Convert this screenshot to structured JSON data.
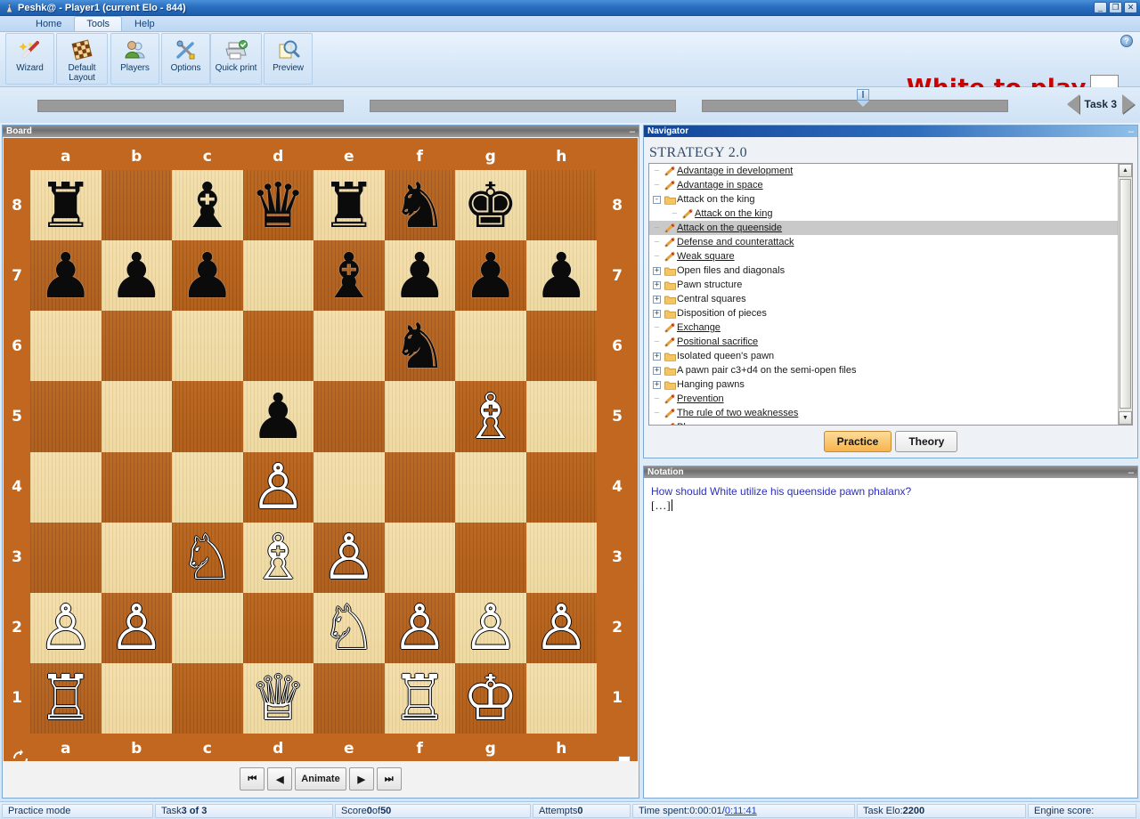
{
  "window": {
    "title": "Peshk@ - Player1 (current Elo - 844)",
    "icon": "chess-pawn-icon",
    "minimize": "_",
    "maximize": "❐",
    "close": "✕"
  },
  "tabs": [
    {
      "label": "Home",
      "active": false
    },
    {
      "label": "Tools",
      "active": true
    },
    {
      "label": "Help",
      "active": false
    }
  ],
  "ribbon": {
    "help_icon": "?",
    "buttons": [
      {
        "label": "Wizard",
        "icon": "magic-wand-icon"
      },
      {
        "label": "Default Layout",
        "line1": "Default",
        "line2": "Layout",
        "icon": "checkerboard-icon"
      },
      {
        "label": "Players",
        "icon": "users-icon"
      },
      {
        "label": "Options",
        "icon": "tools-icon"
      },
      {
        "label": "Quick print",
        "icon": "printer-check-icon"
      },
      {
        "label": "Preview",
        "icon": "magnifier-page-icon"
      }
    ],
    "turn_banner": "White to play",
    "turn_color_swatch": "#ffffff",
    "turn_text_color": "#cc0000"
  },
  "task_nav": {
    "prev_icon": "arrow-left-icon",
    "next_icon": "arrow-right-icon",
    "label": "Task  3"
  },
  "board_panel": {
    "title": "Board",
    "minimize": "–",
    "files": [
      "a",
      "b",
      "c",
      "d",
      "e",
      "f",
      "g",
      "h"
    ],
    "ranks": [
      "8",
      "7",
      "6",
      "5",
      "4",
      "3",
      "2",
      "1"
    ],
    "flip_icon": "flip-board-icon",
    "light_square_color": "#eed9a2",
    "dark_square_color": "#b1601d",
    "border_color": "#c1671f",
    "position": [
      [
        "r",
        "",
        "b",
        "q",
        "r",
        "n",
        "k",
        ""
      ],
      [
        "p",
        "p",
        "p",
        "",
        "b",
        "p",
        "p",
        "p"
      ],
      [
        "",
        "",
        "",
        "",
        "",
        "n",
        "",
        ""
      ],
      [
        "",
        "",
        "",
        "p",
        "",
        "",
        "B",
        ""
      ],
      [
        "",
        "",
        "",
        "P",
        "",
        "",
        "",
        ""
      ],
      [
        "",
        "",
        "N",
        "B",
        "P",
        "",
        "",
        ""
      ],
      [
        "P",
        "P",
        "",
        "",
        "N",
        "P",
        "P",
        "P"
      ],
      [
        "R",
        "",
        "",
        "Q",
        "",
        "R",
        "K",
        ""
      ]
    ],
    "controls": [
      {
        "label": "⏮",
        "name": "first-move-button"
      },
      {
        "label": "◀",
        "name": "previous-move-button"
      },
      {
        "label": "Animate",
        "name": "animate-button"
      },
      {
        "label": "▶",
        "name": "next-move-button"
      },
      {
        "label": "⏭",
        "name": "last-move-button"
      }
    ]
  },
  "navigator": {
    "title": "Navigator",
    "minimize": "–",
    "heading": "STRATEGY 2.0",
    "tree": [
      {
        "label": "Advantage in development",
        "level": 0,
        "type": "leaf",
        "link": true,
        "selected": false
      },
      {
        "label": "Advantage in space",
        "level": 0,
        "type": "leaf",
        "link": true,
        "selected": false
      },
      {
        "label": "Attack on the king",
        "level": 0,
        "type": "folder",
        "expander": "-",
        "link": false,
        "selected": false
      },
      {
        "label": "Attack on the king",
        "level": 1,
        "type": "leaf",
        "link": true,
        "selected": false
      },
      {
        "label": "Attack on the queenside",
        "level": 0,
        "type": "leaf",
        "link": true,
        "selected": true
      },
      {
        "label": "Defense and counterattack",
        "level": 0,
        "type": "leaf",
        "link": true,
        "selected": false
      },
      {
        "label": "Weak square",
        "level": 0,
        "type": "leaf",
        "link": true,
        "selected": false
      },
      {
        "label": "Open files and diagonals",
        "level": 0,
        "type": "folder",
        "expander": "+",
        "link": false,
        "selected": false
      },
      {
        "label": "Pawn structure",
        "level": 0,
        "type": "folder",
        "expander": "+",
        "link": false,
        "selected": false
      },
      {
        "label": "Central squares",
        "level": 0,
        "type": "folder",
        "expander": "+",
        "link": false,
        "selected": false
      },
      {
        "label": "Disposition of pieces",
        "level": 0,
        "type": "folder",
        "expander": "+",
        "link": false,
        "selected": false
      },
      {
        "label": "Exchange",
        "level": 0,
        "type": "leaf",
        "link": true,
        "selected": false
      },
      {
        "label": "Positional sacrifice",
        "level": 0,
        "type": "leaf",
        "link": true,
        "selected": false
      },
      {
        "label": "Isolated queen's pawn",
        "level": 0,
        "type": "folder",
        "expander": "+",
        "link": false,
        "selected": false
      },
      {
        "label": "A pawn pair c3+d4 on the semi-open files",
        "level": 0,
        "type": "folder",
        "expander": "+",
        "link": false,
        "selected": false
      },
      {
        "label": "Hanging pawns",
        "level": 0,
        "type": "folder",
        "expander": "+",
        "link": false,
        "selected": false
      },
      {
        "label": "Prevention",
        "level": 0,
        "type": "leaf",
        "link": true,
        "selected": false
      },
      {
        "label": "The rule of two weaknesses",
        "level": 0,
        "type": "leaf",
        "link": true,
        "selected": false
      },
      {
        "label": "Plan",
        "level": 0,
        "type": "leaf",
        "link": true,
        "selected": false
      }
    ],
    "scroll_up_icon": "▲",
    "scroll_down_icon": "▼",
    "mode_buttons": [
      {
        "label": "Practice",
        "active": true
      },
      {
        "label": "Theory",
        "active": false
      }
    ]
  },
  "notation": {
    "title": "Notation",
    "minimize": "–",
    "question": "How should White utilize his queenside pawn phalanx?",
    "placeholder_move": "[…]"
  },
  "status_bar": {
    "mode": "Practice mode",
    "task": {
      "prefix": "Task ",
      "value": "3 of 3"
    },
    "score": {
      "prefix": "Score ",
      "value": "0",
      "mid": " of ",
      "total": "50"
    },
    "attempts": {
      "prefix": "Attempts ",
      "value": "0"
    },
    "time": {
      "prefix": "Time spent: ",
      "value": "0:00:01",
      "sep": " / ",
      "link": "0:11:41"
    },
    "task_elo": {
      "prefix": "Task Elo: ",
      "value": "2200"
    },
    "engine_score": "Engine score:"
  }
}
